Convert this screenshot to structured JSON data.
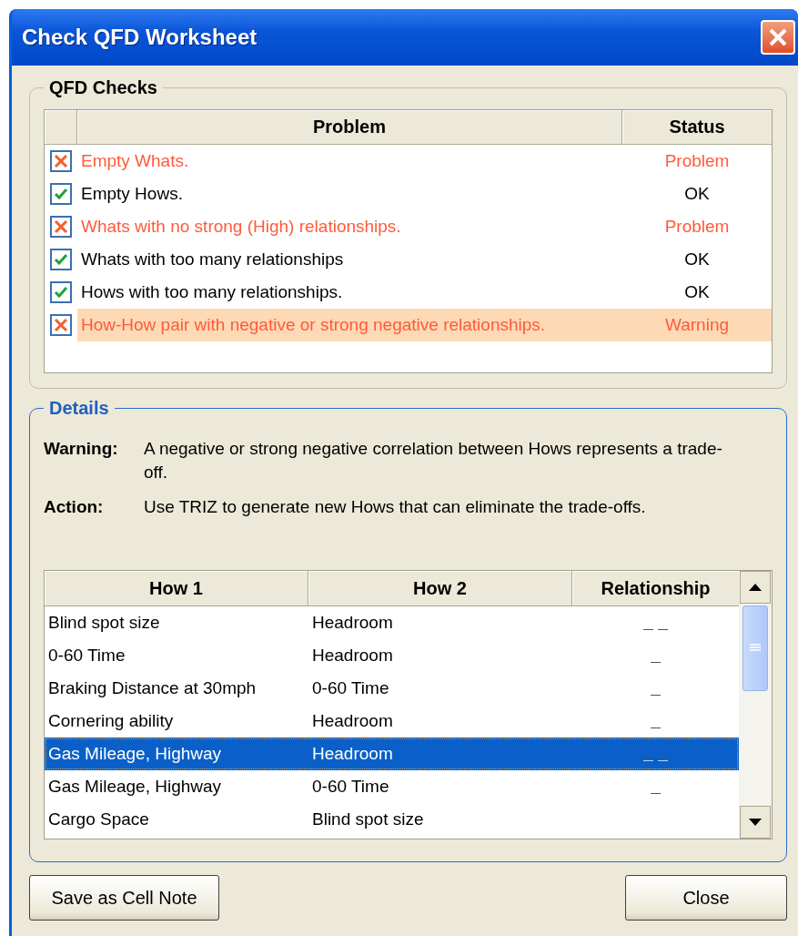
{
  "window": {
    "title": "Check QFD Worksheet"
  },
  "checks": {
    "legend": "QFD Checks",
    "columns": [
      "Problem",
      "Status"
    ],
    "rows": [
      {
        "problem": "Empty Whats.",
        "status": "Problem",
        "passed": false,
        "selected": false
      },
      {
        "problem": "Empty Hows.",
        "status": "OK",
        "passed": true,
        "selected": false
      },
      {
        "problem": "Whats with no strong (High) relationships.",
        "status": "Problem",
        "passed": false,
        "selected": false
      },
      {
        "problem": "Whats with too many relationships",
        "status": "OK",
        "passed": true,
        "selected": false
      },
      {
        "problem": "Hows with too many relationships.",
        "status": "OK",
        "passed": true,
        "selected": false
      },
      {
        "problem": "How-How pair with negative or strong negative relationships.",
        "status": "Warning",
        "passed": false,
        "selected": true
      }
    ]
  },
  "details": {
    "legend": "Details",
    "notes": [
      {
        "label": "Warning:",
        "text": "A negative or strong negative correlation between Hows represents a trade-off."
      },
      {
        "label": "Action:",
        "text": "Use TRIZ to generate new Hows that can eliminate the trade-offs."
      }
    ],
    "table": {
      "columns": [
        "How 1",
        "How 2",
        "Relationship"
      ],
      "rows": [
        {
          "how1": "Blind spot size",
          "how2": "Headroom",
          "relationship": "_ _",
          "selected": false
        },
        {
          "how1": "0-60 Time",
          "how2": "Headroom",
          "relationship": "_",
          "selected": false
        },
        {
          "how1": "Braking Distance at 30mph",
          "how2": "0-60 Time",
          "relationship": "_",
          "selected": false
        },
        {
          "how1": "Cornering ability",
          "how2": "Headroom",
          "relationship": "_",
          "selected": false
        },
        {
          "how1": "Gas Mileage, Highway",
          "how2": "Headroom",
          "relationship": "_ _",
          "selected": true
        },
        {
          "how1": "Gas Mileage, Highway",
          "how2": "0-60 Time",
          "relationship": "_",
          "selected": false
        },
        {
          "how1": "Cargo Space",
          "how2": "Blind spot size",
          "selected": false
        }
      ]
    }
  },
  "buttons": [
    "Save as Cell Note",
    "Close"
  ]
}
